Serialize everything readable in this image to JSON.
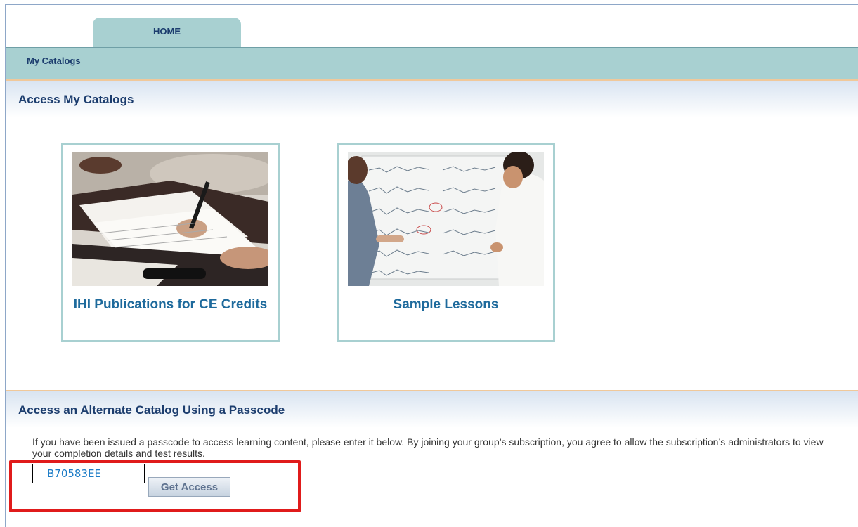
{
  "tabs": {
    "home": "HOME"
  },
  "nav": {
    "my_catalogs": "My Catalogs"
  },
  "sections": {
    "my_catalogs_title": "Access My Catalogs",
    "alternate_title": "Access an Alternate Catalog Using a Passcode"
  },
  "catalogs": [
    {
      "title": "IHI Publications for CE Credits",
      "image": "people-writing-documents-photo"
    },
    {
      "title": "Sample Lessons",
      "image": "people-reviewing-run-charts-photo"
    }
  ],
  "passcode": {
    "description": "If you have been issued a passcode to access learning content, please enter it below. By joining your group’s subscription, you agree to allow the subscription’s administrators to view your completion details and test results.",
    "value": "B70583EE",
    "button_label": "Get Access"
  },
  "colors": {
    "tab_bg": "#a8d0d1",
    "heading_text": "#1c3d6e",
    "card_title": "#1e6a9c",
    "highlight": "#e01b1b"
  }
}
